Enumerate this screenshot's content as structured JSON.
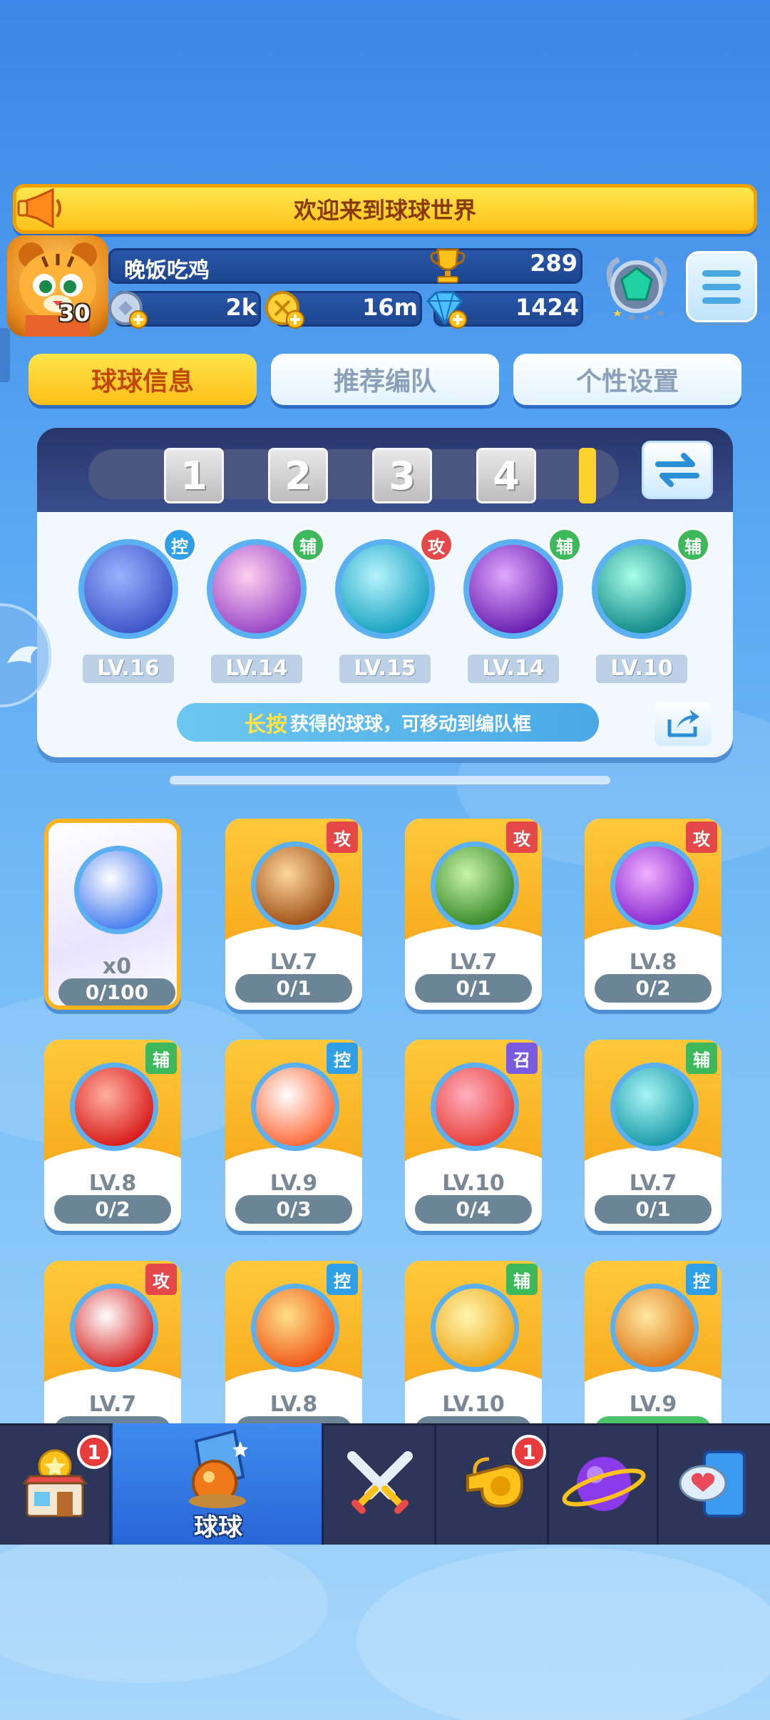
{
  "banner": {
    "text": "欢迎来到球球世界"
  },
  "player": {
    "name": "晚饭吃鸡",
    "level": "30",
    "trophies": "289",
    "silver": "2k",
    "gold": "16m",
    "gems": "1424"
  },
  "tabs": [
    {
      "label": "球球信息",
      "active": true
    },
    {
      "label": "推荐编队",
      "active": false
    },
    {
      "label": "个性设置",
      "active": false
    }
  ],
  "team": {
    "slots": [
      "1",
      "2",
      "3",
      "4"
    ],
    "members": [
      {
        "role": "控",
        "role_color": "#2fa0e8",
        "level": "LV.16",
        "colors": [
          "#9ab4ff",
          "#3f55c8"
        ]
      },
      {
        "role": "辅",
        "role_color": "#3db85a",
        "level": "LV.14",
        "colors": [
          "#ffd0f0",
          "#9a48c8"
        ]
      },
      {
        "role": "攻",
        "role_color": "#e54848",
        "level": "LV.15",
        "colors": [
          "#b6f3ff",
          "#1aa3c0"
        ]
      },
      {
        "role": "辅",
        "role_color": "#3db85a",
        "level": "LV.14",
        "colors": [
          "#e0a8ff",
          "#6a1fb0"
        ]
      },
      {
        "role": "辅",
        "role_color": "#3db85a",
        "level": "LV.10",
        "colors": [
          "#a8ffe8",
          "#138a8a"
        ]
      }
    ],
    "hint_emphasis": "长按",
    "hint_text": "获得的球球，可移动到编队框"
  },
  "cards": [
    {
      "featured": true,
      "role": "",
      "role_color": "",
      "level": "x0",
      "progress": "0/100",
      "colors": [
        "#ffffff",
        "#4a7ef0"
      ]
    },
    {
      "featured": false,
      "role": "攻",
      "role_color": "#e54848",
      "level": "LV.7",
      "progress": "0/1",
      "colors": [
        "#ffd79a",
        "#a0521a"
      ]
    },
    {
      "featured": false,
      "role": "攻",
      "role_color": "#e54848",
      "level": "LV.7",
      "progress": "0/1",
      "colors": [
        "#c8f5a8",
        "#3a8a2a"
      ]
    },
    {
      "featured": false,
      "role": "攻",
      "role_color": "#e54848",
      "level": "LV.8",
      "progress": "0/2",
      "colors": [
        "#f0b0ff",
        "#8a2ad0"
      ]
    },
    {
      "featured": false,
      "role": "辅",
      "role_color": "#3db85a",
      "level": "LV.8",
      "progress": "0/2",
      "colors": [
        "#ffb0a0",
        "#d81c1c"
      ]
    },
    {
      "featured": false,
      "role": "控",
      "role_color": "#2fa0e8",
      "level": "LV.9",
      "progress": "0/3",
      "colors": [
        "#ffffff",
        "#ff6a3a"
      ]
    },
    {
      "featured": false,
      "role": "召",
      "role_color": "#7a5ae0",
      "level": "LV.10",
      "progress": "0/4",
      "colors": [
        "#ffb0c0",
        "#e8403a"
      ]
    },
    {
      "featured": false,
      "role": "辅",
      "role_color": "#3db85a",
      "level": "LV.7",
      "progress": "0/1",
      "colors": [
        "#a8f5f5",
        "#1a9aa8"
      ]
    },
    {
      "featured": false,
      "role": "攻",
      "role_color": "#e54848",
      "level": "LV.7",
      "progress": "",
      "colors": [
        "#ffffff",
        "#d82a2a"
      ]
    },
    {
      "featured": false,
      "role": "控",
      "role_color": "#2fa0e8",
      "level": "LV.8",
      "progress": "",
      "colors": [
        "#ffe08a",
        "#f05a1a"
      ]
    },
    {
      "featured": false,
      "role": "辅",
      "role_color": "#3db85a",
      "level": "LV.10",
      "progress": "",
      "colors": [
        "#fff6b0",
        "#f0a81a"
      ]
    },
    {
      "featured": false,
      "role": "控",
      "role_color": "#2fa0e8",
      "level": "LV.9",
      "progress": "",
      "colors": [
        "#ffe8a0",
        "#e07a1a"
      ]
    }
  ],
  "nav": {
    "items": [
      {
        "name": "shop",
        "badge": "1"
      },
      {
        "name": "balls",
        "label": "球球",
        "active": true
      },
      {
        "name": "battle"
      },
      {
        "name": "whistle",
        "badge": "1"
      },
      {
        "name": "planet"
      },
      {
        "name": "social"
      }
    ]
  },
  "icons": [
    "megaphone-icon",
    "trophy-icon",
    "silver-coin-icon",
    "gold-coin-icon",
    "gem-icon",
    "rank-emblem-icon",
    "menu-icon",
    "swap-icon",
    "share-icon",
    "shop-icon",
    "balls-icon",
    "battle-icon",
    "whistle-icon",
    "planet-icon",
    "social-icon"
  ]
}
